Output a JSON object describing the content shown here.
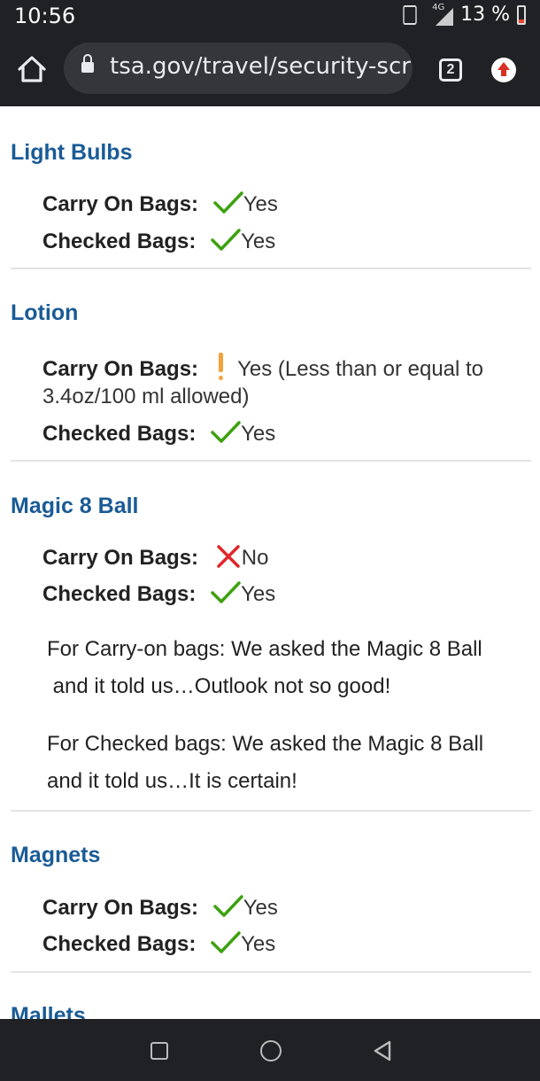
{
  "status_bar": {
    "time": "10:56",
    "network_label": "4G",
    "battery": "13 %",
    "battery_level": 0.13,
    "colors": {
      "battery_low": "#e8442f"
    }
  },
  "browser": {
    "url": "tsa.gov/travel/security-scr",
    "tab_count": "2",
    "icons": [
      "home-icon",
      "lock-icon",
      "tab-switcher-icon",
      "update-icon"
    ],
    "colors": {
      "toolbar_bg": "#202124",
      "omnibox_bg": "#35363a",
      "update": "#d93025"
    }
  },
  "content": {
    "colors": {
      "title": "#1a5b96",
      "yes": "#3da10f",
      "no": "#e0262a",
      "caution": "#f0a43a"
    },
    "items": [
      {
        "title": "Light Bulbs",
        "carry_on_label": "Carry On Bags:",
        "carry_on_value": "Yes",
        "carry_on_status": "yes",
        "checked_label": "Checked Bags:",
        "checked_value": "Yes",
        "checked_status": "yes"
      },
      {
        "title": "Lotion",
        "carry_on_label": "Carry On Bags:",
        "carry_on_value_line1": "Yes (Less than or equal to",
        "carry_on_value_line2": "3.4oz/100 ml allowed)",
        "carry_on_status": "caution",
        "checked_label": "Checked Bags:",
        "checked_value": "Yes",
        "checked_status": "yes"
      },
      {
        "title": "Magic 8 Ball",
        "carry_on_label": "Carry On Bags:",
        "carry_on_value": "No",
        "carry_on_status": "no",
        "checked_label": "Checked Bags:",
        "checked_value": "Yes",
        "checked_status": "yes",
        "note1_line1": "For Carry-on bags: We asked the Magic 8 Ball",
        "note1_line2": " and it told us…Outlook not so good!",
        "note2_line1": "For Checked bags: We asked the Magic 8 Ball",
        "note2_line2": "and it told us…It is certain!"
      },
      {
        "title": "Magnets",
        "carry_on_label": "Carry On Bags:",
        "carry_on_value": "Yes",
        "carry_on_status": "yes",
        "checked_label": "Checked Bags:",
        "checked_value": "Yes",
        "checked_status": "yes"
      },
      {
        "title": "Mallets"
      }
    ]
  },
  "nav_bar": {
    "icons": [
      "recents-icon",
      "home-nav-icon",
      "back-icon"
    ]
  }
}
